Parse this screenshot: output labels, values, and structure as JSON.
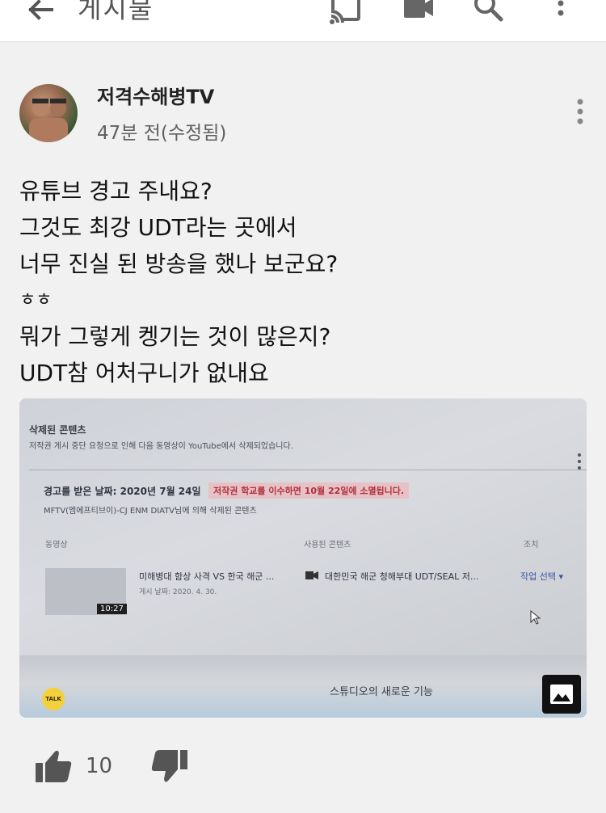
{
  "appbar": {
    "title": "게시물",
    "icons": [
      "back-arrow-icon",
      "cast-icon",
      "video-camera-icon",
      "search-icon",
      "more-vert-icon"
    ]
  },
  "post": {
    "channel_name": "저격수해병TV",
    "time": "47분 전(수정됨)",
    "lines": [
      "유튜브 경고 주내요?",
      "그것도 최강 UDT라는 곳에서",
      "너무 진실 된 방송을 했나 보군요?",
      "ㅎㅎ",
      "뭐가 그렇게 켕기는 것이 많은지?",
      "UDT참 어처구니가 없내요"
    ],
    "like_count": "10"
  },
  "photo": {
    "heading": "삭제된 콘텐츠",
    "description": "저작권 게시 중단 요청으로 인해 다음 동영상이 YouTube에서 삭제되었습니다.",
    "warning_date": "경고를 받은 날짜: 2020년 7월 24일",
    "warning_note": "저작권 학교를 이수하면 10월 22일에 소멸됩니다.",
    "claimant": "MFTV(엠에프티브이)-CJ ENM DIATV님에 의해 삭제된 콘텐츠",
    "columns": [
      "동영상",
      "사용된 콘텐츠",
      "조치"
    ],
    "video_title": "미해병대 함상 사격 VS 한국 해군 ...",
    "video_date": "게시 날짜: 2020. 4. 30.",
    "duration": "10:27",
    "used_content": "대한민국 해군 청해부대 UDT/SEAL 저...",
    "action": "작업 선택 ▾",
    "studio_text": "스튜디오의 새로운 기능",
    "talk_label": "TALK"
  }
}
